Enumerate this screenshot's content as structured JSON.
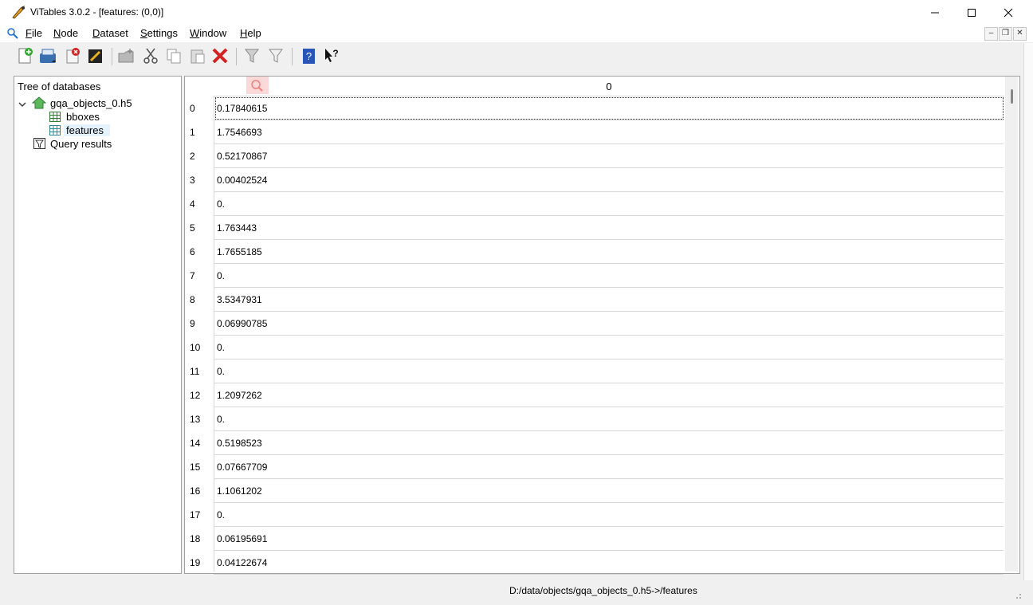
{
  "window": {
    "title": "ViTables 3.0.2 - [features: (0,0)]"
  },
  "menu": {
    "items": [
      "File",
      "Node",
      "Dataset",
      "Settings",
      "Window",
      "Help"
    ],
    "mnemonics": [
      "F",
      "N",
      "D",
      "S",
      "W",
      "H"
    ]
  },
  "tree": {
    "header": "Tree of databases",
    "file": "gqa_objects_0.h5",
    "datasets": [
      "bboxes",
      "features"
    ],
    "query_results": "Query results"
  },
  "table": {
    "column_header": "0",
    "rows": [
      {
        "index": "0",
        "value": "0.17840615"
      },
      {
        "index": "1",
        "value": "1.7546693"
      },
      {
        "index": "2",
        "value": "0.52170867"
      },
      {
        "index": "3",
        "value": "0.00402524"
      },
      {
        "index": "4",
        "value": "0."
      },
      {
        "index": "5",
        "value": "1.763443"
      },
      {
        "index": "6",
        "value": "1.7655185"
      },
      {
        "index": "7",
        "value": "0."
      },
      {
        "index": "8",
        "value": "3.5347931"
      },
      {
        "index": "9",
        "value": "0.06990785"
      },
      {
        "index": "10",
        "value": "0."
      },
      {
        "index": "11",
        "value": "0."
      },
      {
        "index": "12",
        "value": "1.2097262"
      },
      {
        "index": "13",
        "value": "0."
      },
      {
        "index": "14",
        "value": "0.5198523"
      },
      {
        "index": "15",
        "value": "0.07667709"
      },
      {
        "index": "16",
        "value": "1.1061202"
      },
      {
        "index": "17",
        "value": "0."
      },
      {
        "index": "18",
        "value": "0.06195691"
      },
      {
        "index": "19",
        "value": "0.04122674"
      }
    ]
  },
  "status": {
    "path": "D:/data/objects/gqa_objects_0.h5->/features"
  },
  "colors": {
    "accent": "#1e6fd9",
    "delete_red": "#d42020",
    "tree_icon_green": "#3a9a3a",
    "dataset_icon_teal": "#2a8a9a"
  }
}
